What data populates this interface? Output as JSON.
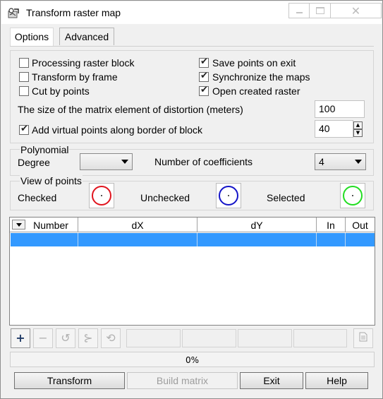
{
  "window": {
    "title": "Transform raster map",
    "min_icon": "minimize-icon",
    "max_icon": "maximize-icon",
    "close_icon": "close-icon"
  },
  "tabs": [
    {
      "label": "Options",
      "active": false
    },
    {
      "label": "Advanced",
      "active": true
    }
  ],
  "options": {
    "processing_block": {
      "label": "Processing raster block",
      "checked": false
    },
    "transform_by_frame": {
      "label": "Transform by frame",
      "checked": false
    },
    "cut_by_points": {
      "label": "Cut by points",
      "checked": false
    },
    "save_points": {
      "label": "Save points on exit",
      "checked": true
    },
    "synchronize_maps": {
      "label": "Synchronize the maps",
      "checked": true
    },
    "open_raster": {
      "label": "Open created raster",
      "checked": true
    },
    "matrix_size_label": "The size of the matrix element of distortion (meters)",
    "matrix_size_value": "100",
    "virtual_points": {
      "label": "Add virtual points along border of block",
      "checked": true
    },
    "virtual_points_value": "40"
  },
  "polynomial": {
    "group_label": "Polynomial",
    "degree_label": "Degree",
    "degree_value": "",
    "coefficients_label": "Number of coefficients",
    "coefficients_value": "4"
  },
  "view_points": {
    "group_label": "View of points",
    "checked_label": "Checked",
    "unchecked_label": "Unchecked",
    "selected_label": "Selected",
    "colors": {
      "checked": "#e0141e",
      "unchecked": "#1414c8",
      "selected": "#22dd22"
    }
  },
  "table": {
    "columns": [
      "Number",
      "dX",
      "dY",
      "In",
      "Out"
    ],
    "selected_row_color": "#3399ff"
  },
  "toolbar": {
    "add": "+",
    "remove": "−",
    "rotate": "↺",
    "split": "⊱",
    "redo": "⟲"
  },
  "progress": {
    "value": 0,
    "label": "0%"
  },
  "buttons": {
    "transform": "Transform",
    "build_matrix": "Build matrix",
    "exit": "Exit",
    "help": "Help"
  }
}
